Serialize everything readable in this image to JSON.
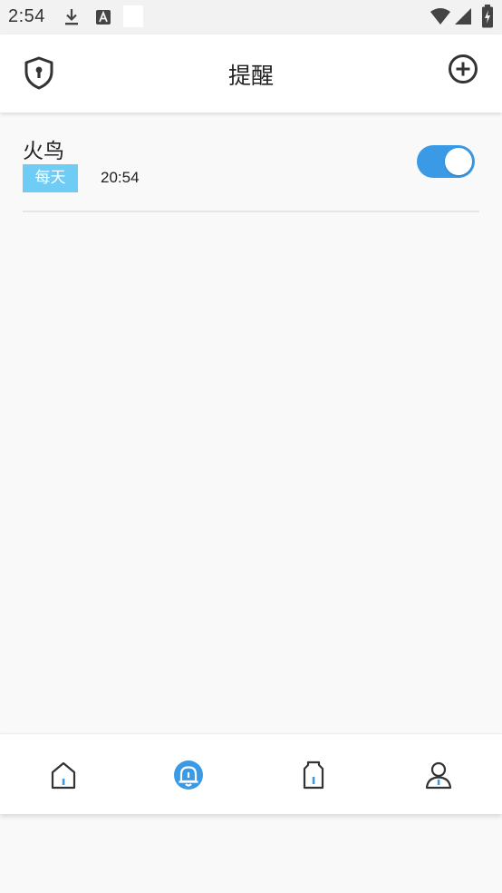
{
  "status_bar": {
    "time": "2:54"
  },
  "app_bar": {
    "title": "提醒",
    "left_icon": "shield-lock-icon",
    "right_icon": "add-circle-icon"
  },
  "reminders": [
    {
      "name": "火鸟",
      "repeat": "每天",
      "time": "20:54",
      "enabled": true
    }
  ],
  "bottom_nav": {
    "items": [
      {
        "icon": "home-icon",
        "active": false
      },
      {
        "icon": "alarm-bell-icon",
        "active": true
      },
      {
        "icon": "bottle-icon",
        "active": false
      },
      {
        "icon": "profile-icon",
        "active": false
      }
    ]
  },
  "colors": {
    "accent": "#3a9ae6",
    "tag": "#6fccf4",
    "background": "#f9f9f9",
    "icon": "#333333"
  }
}
